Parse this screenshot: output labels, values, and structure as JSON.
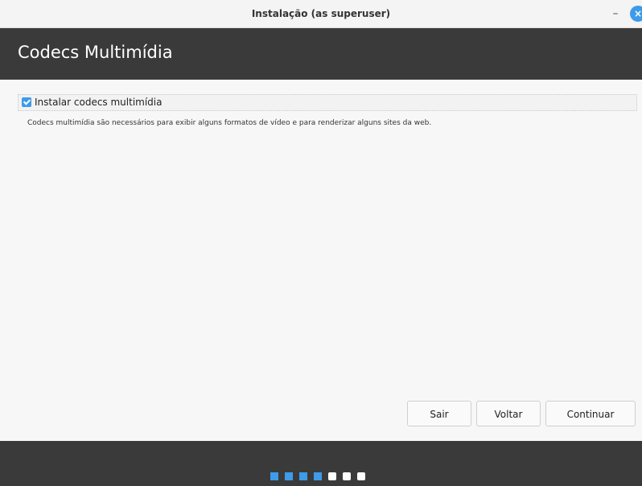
{
  "window": {
    "title": "Instalação (as superuser)",
    "minimize_label": "–",
    "close_label": "×"
  },
  "header": {
    "title": "Codecs Multimídia"
  },
  "option": {
    "label": "Instalar codecs multimídia",
    "checked": true
  },
  "description": "Codecs multimídia são necessários para exibir alguns formatos de vídeo e para renderizar alguns sites da web.",
  "buttons": {
    "quit": "Sair",
    "back": "Voltar",
    "continue": "Continuar"
  },
  "progress": {
    "steps_total": 7,
    "steps_done": 4
  },
  "colors": {
    "accent": "#3d9be9",
    "header_bg": "#3a3a3a"
  }
}
